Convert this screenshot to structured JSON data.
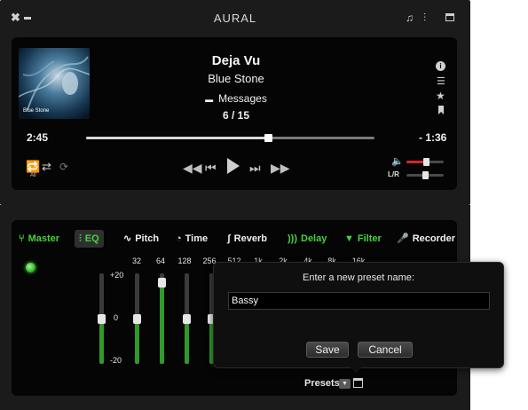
{
  "app": {
    "title": "AURAL"
  },
  "player": {
    "track_title": "Deja Vu",
    "artist": "Blue Stone",
    "playlist": "Messages",
    "track_position": "6 / 15",
    "elapsed": "2:45",
    "remaining": "- 1:36",
    "seek_progress": 0.63,
    "album_art_text": "Blue Stone",
    "repeat_sub": "All",
    "volume_level": 0.52,
    "balance_label": "L/R",
    "balance_level": 0.5
  },
  "effects": {
    "tabs": [
      {
        "label": "Master",
        "icon": "master-icon",
        "active_color": "green"
      },
      {
        "label": "EQ",
        "icon": "eq-icon",
        "selected": true
      },
      {
        "label": "Pitch",
        "icon": "pitch-icon"
      },
      {
        "label": "Time",
        "icon": "time-icon"
      },
      {
        "label": "Reverb",
        "icon": "reverb-icon"
      },
      {
        "label": "Delay",
        "icon": "delay-icon"
      },
      {
        "label": "Filter",
        "icon": "filter-icon"
      },
      {
        "label": "Recorder",
        "icon": "recorder-icon"
      }
    ],
    "eq": {
      "scale_top": "+20",
      "scale_mid": "0",
      "scale_bottom": "-20",
      "bands": [
        "32",
        "64",
        "128",
        "256",
        "512",
        "1k",
        "2k",
        "4k",
        "8k",
        "16k"
      ],
      "levels_db": [
        0,
        0,
        16,
        0,
        0
      ],
      "presets_label": "Presets"
    }
  },
  "dialog": {
    "prompt": "Enter a new preset name:",
    "value": "Bassy",
    "save_label": "Save",
    "cancel_label": "Cancel"
  },
  "colors": {
    "accent_green": "#43d13d",
    "volume_red": "#d8262b",
    "panel": "#050505",
    "chrome": "#1b1b1b"
  }
}
